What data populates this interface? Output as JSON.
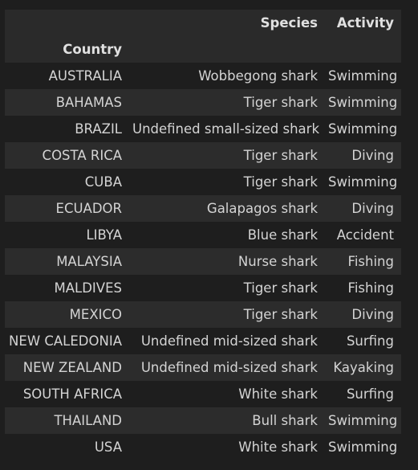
{
  "table": {
    "header": {
      "columns": [
        "",
        "Species",
        "Activity"
      ],
      "index_name": "Country"
    },
    "rows": [
      {
        "country": "AUSTRALIA",
        "species": "Wobbegong shark",
        "activity": "Swimming"
      },
      {
        "country": "BAHAMAS",
        "species": "Tiger shark",
        "activity": "Swimming"
      },
      {
        "country": "BRAZIL",
        "species": "Undefined small-sized shark",
        "activity": "Swimming"
      },
      {
        "country": "COSTA RICA",
        "species": "Tiger shark",
        "activity": "Diving"
      },
      {
        "country": "CUBA",
        "species": "Tiger shark",
        "activity": "Swimming"
      },
      {
        "country": "ECUADOR",
        "species": "Galapagos shark",
        "activity": "Diving"
      },
      {
        "country": "LIBYA",
        "species": "Blue shark",
        "activity": "Accident"
      },
      {
        "country": "MALAYSIA",
        "species": "Nurse shark",
        "activity": "Fishing"
      },
      {
        "country": "MALDIVES",
        "species": "Tiger shark",
        "activity": "Fishing"
      },
      {
        "country": "MEXICO",
        "species": "Tiger shark",
        "activity": "Diving"
      },
      {
        "country": "NEW CALEDONIA",
        "species": "Undefined mid-sized shark",
        "activity": "Surfing"
      },
      {
        "country": "NEW ZEALAND",
        "species": "Undefined mid-sized shark",
        "activity": "Kayaking"
      },
      {
        "country": "SOUTH AFRICA",
        "species": "White shark",
        "activity": "Surfing"
      },
      {
        "country": "THAILAND",
        "species": "Bull shark",
        "activity": "Swimming"
      },
      {
        "country": "USA",
        "species": "White shark",
        "activity": "Swimming"
      }
    ]
  }
}
